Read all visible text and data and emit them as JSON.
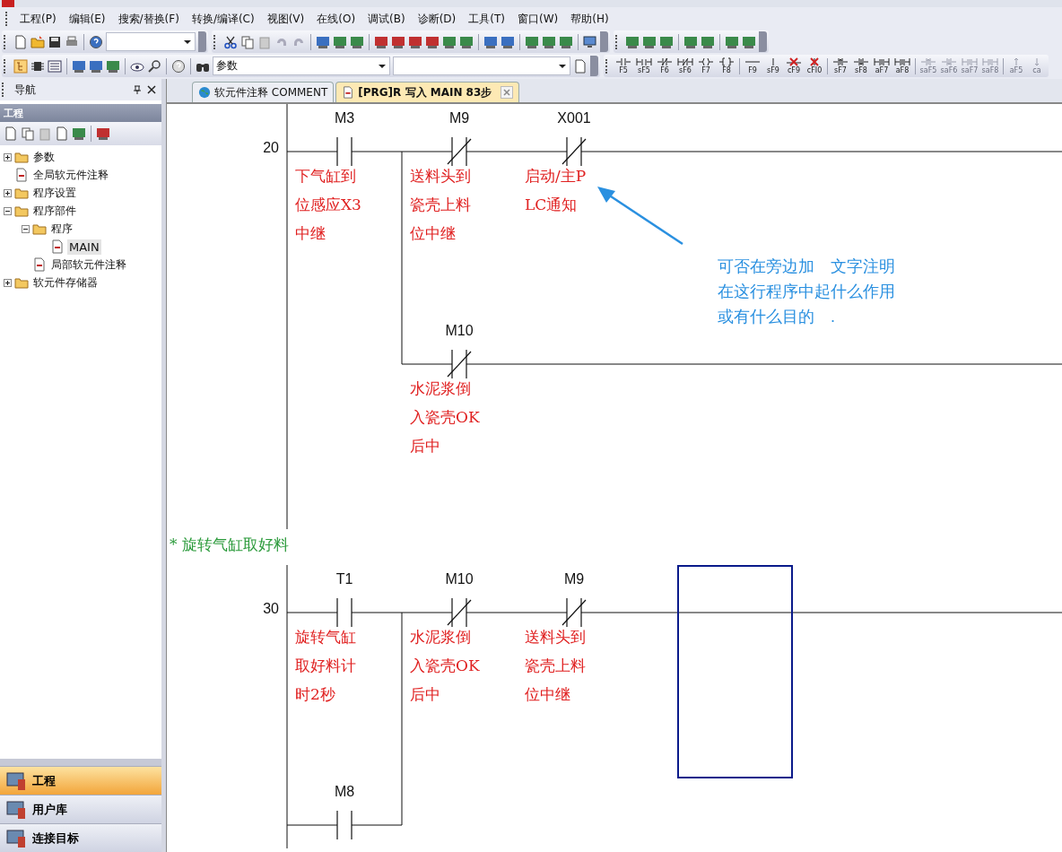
{
  "menu": [
    "工程(P)",
    "编辑(E)",
    "搜索/替换(F)",
    "转换/编译(C)",
    "视图(V)",
    "在线(O)",
    "调试(B)",
    "诊断(D)",
    "工具(T)",
    "窗口(W)",
    "帮助(H)"
  ],
  "parameter_combo": {
    "value": "参数"
  },
  "ladder_toolbar": [
    [
      {
        "label": "F5",
        "disabled": false
      },
      {
        "label": "sF5",
        "disabled": false
      },
      {
        "label": "F6",
        "disabled": false
      },
      {
        "label": "sF6",
        "disabled": false
      },
      {
        "label": "F7",
        "disabled": false
      },
      {
        "label": "F8",
        "disabled": false
      }
    ],
    [
      {
        "label": "F9",
        "disabled": false
      },
      {
        "label": "sF9",
        "disabled": false
      },
      {
        "label": "cF9",
        "disabled": false
      },
      {
        "label": "cFI0",
        "disabled": false
      }
    ],
    [
      {
        "label": "sF7",
        "disabled": false
      },
      {
        "label": "sF8",
        "disabled": false
      },
      {
        "label": "aF7",
        "disabled": false
      },
      {
        "label": "aF8",
        "disabled": false
      }
    ],
    [
      {
        "label": "saF5",
        "disabled": true
      },
      {
        "label": "saF6",
        "disabled": true
      },
      {
        "label": "saF7",
        "disabled": true
      },
      {
        "label": "saF8",
        "disabled": true
      }
    ],
    [
      {
        "label": "aF5",
        "disabled": true
      },
      {
        "label": "ca",
        "disabled": true
      }
    ]
  ],
  "navigation": {
    "title": "导航",
    "section": "工程",
    "tree": [
      {
        "label": "参数",
        "kind": "node",
        "expanded": false,
        "selected": false
      },
      {
        "label": "全局软元件注释",
        "kind": "leaf",
        "selected": false
      },
      {
        "label": "程序设置",
        "kind": "node",
        "expanded": false,
        "selected": false
      },
      {
        "label": "程序部件",
        "kind": "node",
        "expanded": true,
        "selected": false,
        "children": [
          {
            "label": "程序",
            "kind": "node",
            "expanded": true,
            "selected": false,
            "children": [
              {
                "label": "MAIN",
                "kind": "leaf",
                "selected": true
              }
            ]
          },
          {
            "label": "局部软元件注释",
            "kind": "leaf",
            "selected": false
          }
        ]
      },
      {
        "label": "软元件存储器",
        "kind": "node",
        "expanded": false,
        "selected": false
      }
    ],
    "panels": [
      {
        "label": "工程",
        "selected": true
      },
      {
        "label": "用户库",
        "selected": false
      },
      {
        "label": "连接目标",
        "selected": false
      }
    ]
  },
  "tabs": [
    {
      "label": "软元件注释 COMMENT",
      "selected": false,
      "closable": false
    },
    {
      "label": "[PRG]R 写入 MAIN 83步",
      "selected": true,
      "closable": true
    }
  ],
  "ladder": [
    {
      "kind": "rung",
      "step": "20",
      "elements": [
        {
          "kind": "open_contact",
          "device": "M3",
          "selected": false,
          "comment": [
            "下气缸到",
            "位感应X3",
            "中继"
          ]
        },
        {
          "kind": "parallel",
          "branches": [
            [
              {
                "kind": "closed_contact",
                "device": "M9",
                "selected": false,
                "comment": [
                  "送料头到",
                  "瓷壳上料",
                  "位中继"
                ]
              },
              {
                "kind": "closed_contact",
                "device": "X001",
                "selected": false,
                "comment": [
                  "启动/主P",
                  "LC通知"
                ]
              }
            ],
            [
              {
                "kind": "closed_contact",
                "device": "M10",
                "selected": false,
                "comment": [
                  "水泥浆倒",
                  "入瓷壳OK",
                  "后中"
                ]
              }
            ]
          ]
        }
      ],
      "annotation": {
        "lines": [
          "可否在旁边加　文字注明",
          "在这行程序中起什么作用",
          "或有什么目的　."
        ]
      }
    },
    {
      "kind": "statement",
      "text": "* 旋转气缸取好料"
    },
    {
      "kind": "rung",
      "step": "30",
      "elements": [
        {
          "kind": "parallel",
          "branches": [
            [
              {
                "kind": "open_contact",
                "device": "T1",
                "selected": false,
                "comment": [
                  "旋转气缸",
                  "取好料计",
                  "时2秒"
                ]
              }
            ],
            [
              {
                "kind": "open_contact",
                "device": "M8",
                "selected": false
              }
            ]
          ]
        },
        {
          "kind": "closed_contact",
          "device": "M10",
          "selected": false,
          "comment": [
            "水泥浆倒",
            "入瓷壳OK",
            "后中"
          ]
        },
        {
          "kind": "closed_contact",
          "device": "M9",
          "selected": false,
          "comment": [
            "送料头到",
            "瓷壳上料",
            "位中继"
          ]
        },
        {
          "kind": "empty",
          "selected": true
        }
      ]
    }
  ]
}
